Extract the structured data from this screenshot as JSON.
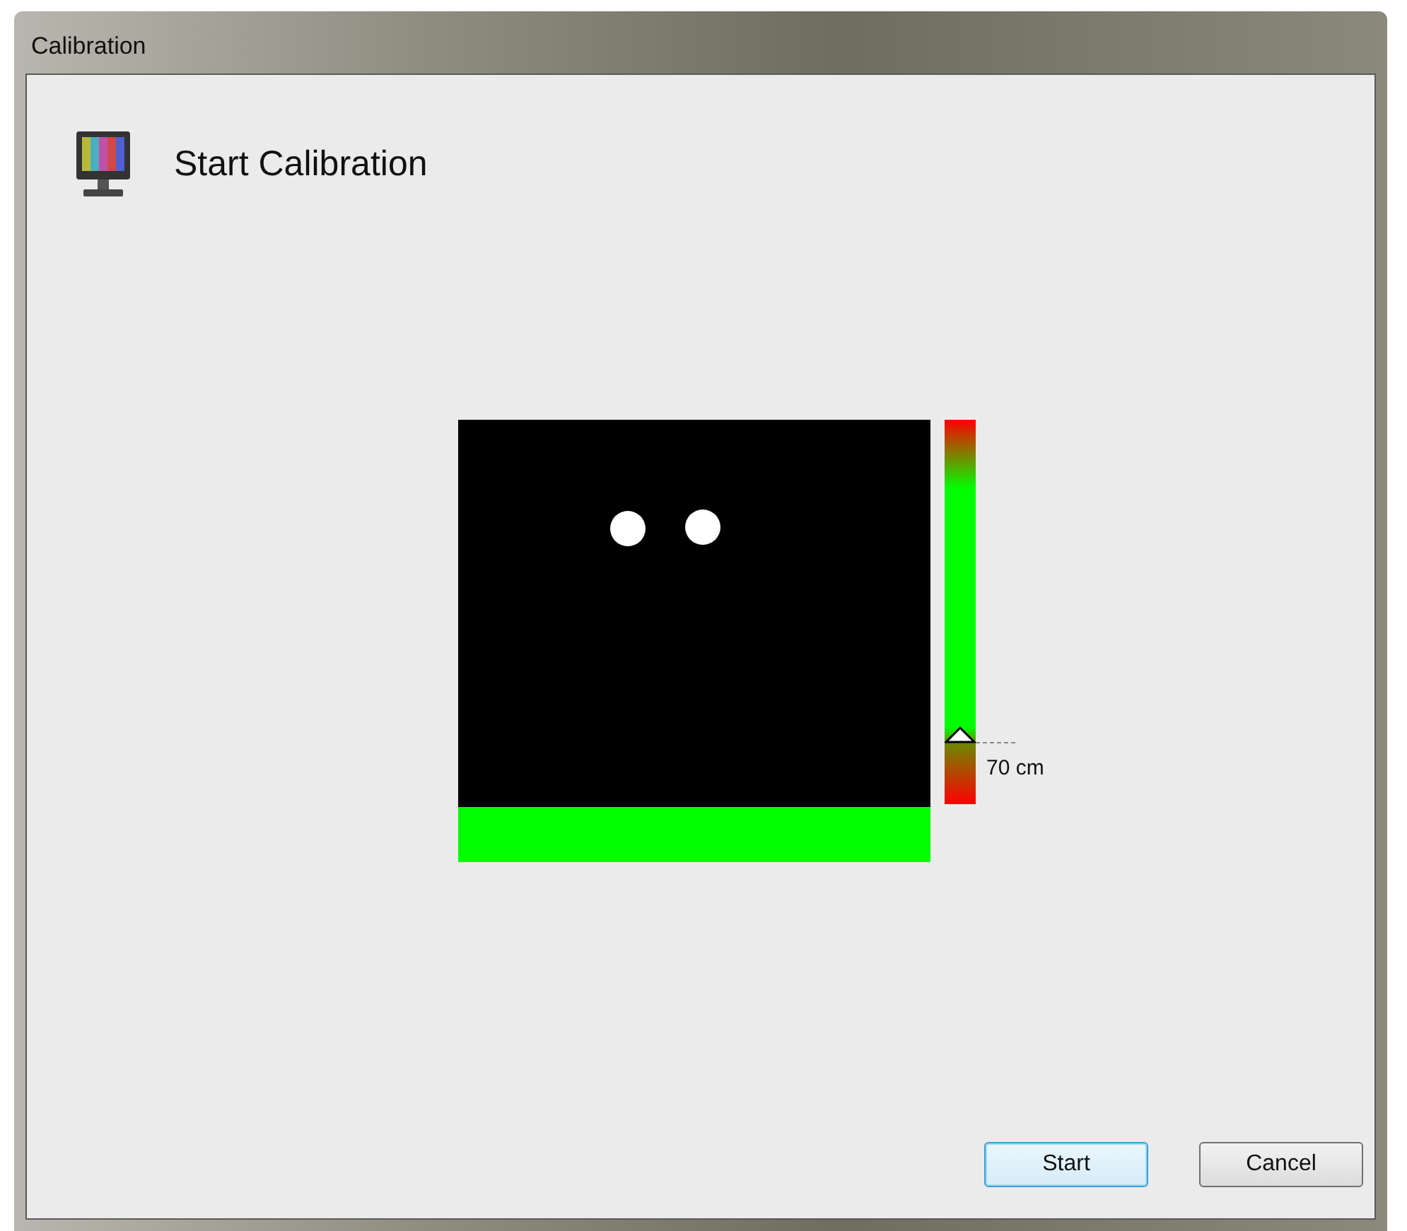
{
  "window": {
    "title": "Calibration"
  },
  "header": {
    "title": "Start Calibration"
  },
  "distance_meter": {
    "level": 0.16,
    "reading": "70 cm"
  },
  "buttons": [
    {
      "label": "Start",
      "focused": true
    },
    {
      "label": "Cancel",
      "focused": false
    }
  ]
}
